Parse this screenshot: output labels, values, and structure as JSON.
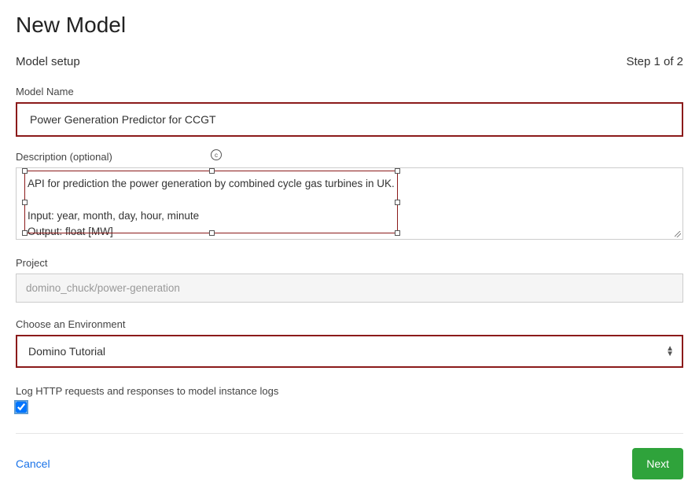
{
  "page_title": "New Model",
  "setup_label": "Model setup",
  "step_label": "Step 1 of 2",
  "fields": {
    "model_name": {
      "label": "Model Name",
      "value": "Power Generation Predictor for CCGT"
    },
    "description": {
      "label": "Description (optional)",
      "value": "API for prediction the power generation by combined cycle gas turbines in UK.\n\nInput: year, month, day, hour, minute\nOutput: float [MW]"
    },
    "project": {
      "label": "Project",
      "value": "domino_chuck/power-generation"
    },
    "environment": {
      "label": "Choose an Environment",
      "value": "Domino Tutorial"
    },
    "log_http": {
      "label": "Log HTTP requests and responses to model instance logs",
      "checked": true
    }
  },
  "footer": {
    "cancel_label": "Cancel",
    "next_label": "Next"
  }
}
